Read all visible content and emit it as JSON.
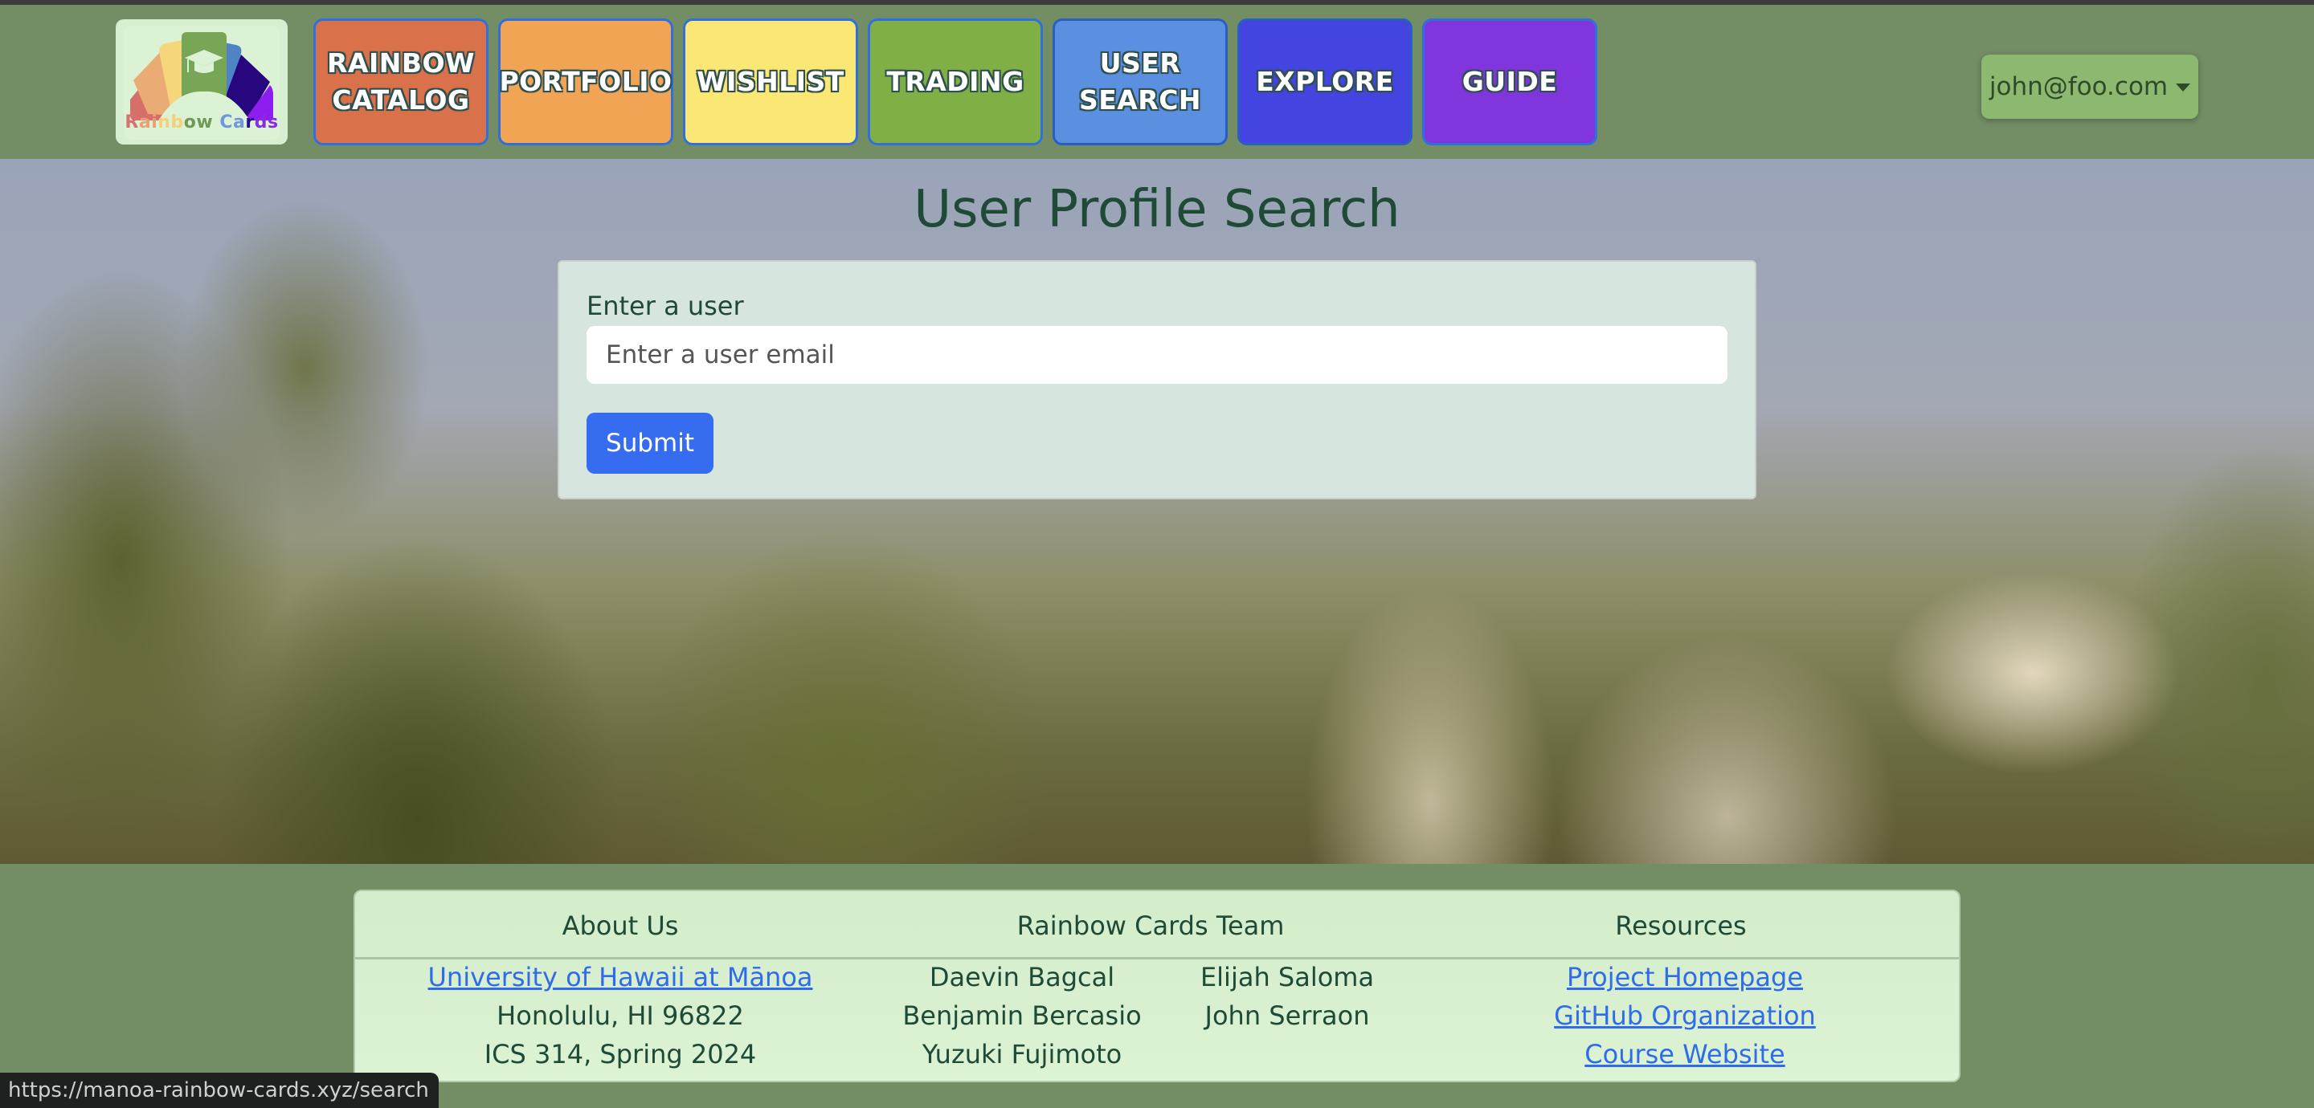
{
  "brand": {
    "logo_text": "Rainbow Cards",
    "logo_letters": [
      {
        "ch": "R",
        "color": "#d7716c"
      },
      {
        "ch": "a",
        "color": "#e8a073"
      },
      {
        "ch": "i",
        "color": "#e8a073"
      },
      {
        "ch": "n",
        "color": "#f4d178"
      },
      {
        "ch": "b",
        "color": "#f4d178"
      },
      {
        "ch": "o",
        "color": "#6f9a55"
      },
      {
        "ch": "w",
        "color": "#6f9a55"
      },
      {
        "ch": " ",
        "color": "#000"
      },
      {
        "ch": "C",
        "color": "#6f97e0"
      },
      {
        "ch": "a",
        "color": "#6f97e0"
      },
      {
        "ch": "r",
        "color": "#2a0a8a"
      },
      {
        "ch": "d",
        "color": "#8a2be2"
      },
      {
        "ch": "s",
        "color": "#8a2be2"
      }
    ],
    "icon": "graduation-cap-icon"
  },
  "nav": {
    "items": [
      {
        "label": "RAINBOW\nCATALOG",
        "color": "#d9714a"
      },
      {
        "label": "PORTFOLIO",
        "color": "#f2a455"
      },
      {
        "label": "WISHLIST",
        "color": "#fbe874"
      },
      {
        "label": "TRADING",
        "color": "#80b045"
      },
      {
        "label": "USER\nSEARCH",
        "color": "#5b8fe0"
      },
      {
        "label": "EXPLORE",
        "color": "#4444e0"
      },
      {
        "label": "GUIDE",
        "color": "#8136dd"
      }
    ],
    "user_menu": {
      "label": "john@foo.com",
      "icon": "caret-down-icon"
    }
  },
  "main": {
    "title": "User Profile Search",
    "form": {
      "label": "Enter a user",
      "input_value": "",
      "input_placeholder": "Enter a user email",
      "submit_label": "Submit"
    }
  },
  "footer": {
    "about": {
      "heading": "About Us",
      "link": "University of Hawaii at Mānoa",
      "lines": [
        "Honolulu, HI 96822",
        "ICS 314, Spring 2024"
      ]
    },
    "team": {
      "heading": "Rainbow Cards Team",
      "col1": [
        "Daevin Bagcal",
        "Benjamin Bercasio",
        "Yuzuki Fujimoto"
      ],
      "col2": [
        "Elijah Saloma",
        "John Serraon"
      ]
    },
    "resources": {
      "heading": "Resources",
      "links": [
        "Project Homepage",
        "GitHub Organization",
        "Course Website"
      ]
    }
  },
  "status_bar": {
    "url": "https://manoa-rainbow-cards.xyz/search"
  },
  "colors": {
    "navbar_bg": "#738e65",
    "title_text": "#1e4a36",
    "primary_button": "#356cf0",
    "link": "#2f6bea"
  }
}
